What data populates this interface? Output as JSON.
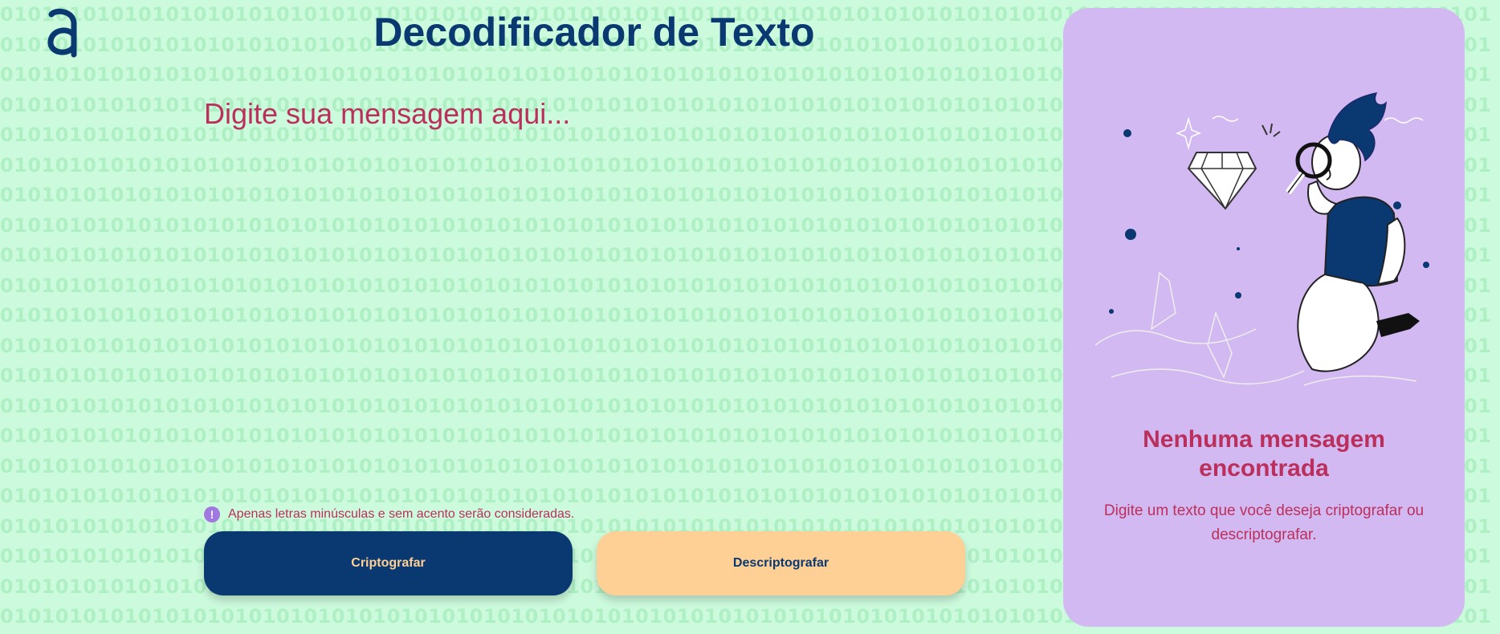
{
  "app": {
    "title": "Decodificador de Texto",
    "logo_icon": "alura-a-logo-icon"
  },
  "editor": {
    "placeholder": "Digite sua mensagem aqui...",
    "value": ""
  },
  "hint": {
    "icon": "exclamation-circle-icon",
    "text": "Apenas letras minúsculas e sem acento serão consideradas."
  },
  "actions": {
    "encrypt_label": "Criptografar",
    "decrypt_label": "Descriptografar"
  },
  "output_panel": {
    "illustration": "person-with-magnifying-glass-diamond-illustration",
    "title": "Nenhuma mensagem encontrada",
    "message": "Digite um texto que você deseja criptografar ou descriptografar."
  },
  "theme": {
    "background": "#ccfadc",
    "primary": "#0a3871",
    "accent": "#ffd095",
    "text_accent": "#bb2f5c",
    "panel": "#d3b9f1"
  }
}
